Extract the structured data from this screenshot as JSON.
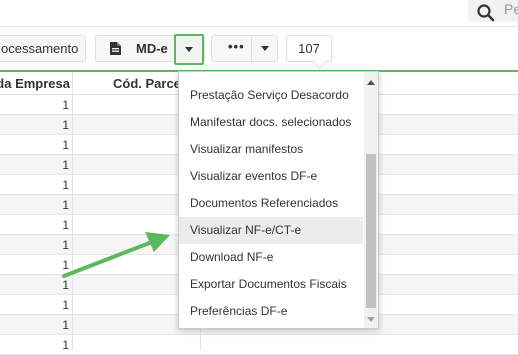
{
  "search": {
    "placeholder": "Pe"
  },
  "toolbar": {
    "process_label": "ocessamento",
    "mde_label": "MD-e",
    "more_label": "•••",
    "count": "107"
  },
  "table": {
    "columns": [
      "da Empresa",
      "Cód. Parce"
    ],
    "rows": [
      "1",
      "1",
      "1",
      "1",
      "1",
      "1",
      "1",
      "1",
      "1",
      "1",
      "1",
      "1",
      "1"
    ]
  },
  "dropdown": {
    "items": [
      "Prestação Serviço Desacordo",
      "Manifestar docs. selecionados",
      "Visualizar manifestos",
      "Visualizar eventos DF-e",
      "Documentos Referenciados",
      "Visualizar NF-e/CT-e",
      "Download NF-e",
      "Exportar Documentos Fiscais",
      "Preferências DF-e"
    ],
    "highlighted_index": 5
  },
  "colors": {
    "accent": "#5cb85c",
    "highlight": "#ececec"
  }
}
